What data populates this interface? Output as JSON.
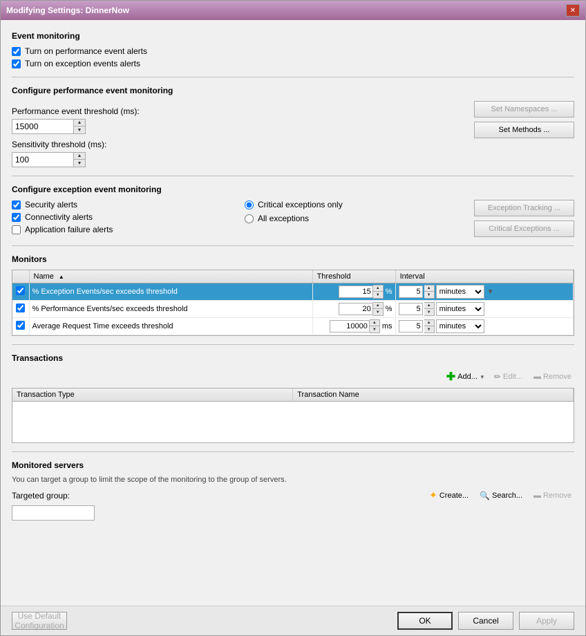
{
  "window": {
    "title": "Modifying Settings: DinnerNow"
  },
  "event_monitoring": {
    "section_title": "Event monitoring",
    "checkbox1_label": "Turn on performance event alerts",
    "checkbox2_label": "Turn on exception events alerts",
    "checkbox1_checked": true,
    "checkbox2_checked": true
  },
  "performance_monitoring": {
    "section_title": "Configure performance event monitoring",
    "perf_threshold_label": "Performance event threshold (ms):",
    "perf_threshold_value": "15000",
    "sensitivity_label": "Sensitivity threshold (ms):",
    "sensitivity_value": "100",
    "set_namespaces_label": "Set Namespaces ...",
    "set_methods_label": "Set Methods ..."
  },
  "exception_monitoring": {
    "section_title": "Configure exception event monitoring",
    "security_label": "Security alerts",
    "connectivity_label": "Connectivity alerts",
    "app_failure_label": "Application failure alerts",
    "security_checked": true,
    "connectivity_checked": true,
    "app_failure_checked": false,
    "critical_only_label": "Critical exceptions only",
    "all_exceptions_label": "All exceptions",
    "critical_only_selected": true,
    "exception_tracking_label": "Exception Tracking ...",
    "critical_exceptions_label": "Critical Exceptions ..."
  },
  "monitors": {
    "section_title": "Monitors",
    "columns": [
      "",
      "Name",
      "Threshold",
      "Interval"
    ],
    "rows": [
      {
        "checked": true,
        "name": "% Exception Events/sec exceeds threshold",
        "threshold_value": "15",
        "threshold_unit": "%",
        "interval_value": "5",
        "interval_unit": "minutes",
        "selected": true
      },
      {
        "checked": true,
        "name": "% Performance Events/sec exceeds threshold",
        "threshold_value": "20",
        "threshold_unit": "%",
        "interval_value": "5",
        "interval_unit": "minutes",
        "selected": false
      },
      {
        "checked": true,
        "name": "Average Request Time exceeds threshold",
        "threshold_value": "10000",
        "threshold_unit": "ms",
        "interval_value": "5",
        "interval_unit": "minutes",
        "selected": false
      }
    ]
  },
  "transactions": {
    "section_title": "Transactions",
    "add_label": "Add...",
    "edit_label": "Edit...",
    "remove_label": "Remove",
    "columns": [
      "Transaction Type",
      "Transaction Name"
    ]
  },
  "monitored_servers": {
    "section_title": "Monitored servers",
    "description": "You can target a group to limit the scope of the monitoring to the group of servers.",
    "targeted_group_label": "Targeted group:",
    "create_label": "Create...",
    "search_label": "Search...",
    "remove_label": "Remove"
  },
  "bottom_bar": {
    "use_default_label": "Use Default Configuration",
    "ok_label": "OK",
    "cancel_label": "Cancel",
    "apply_label": "Apply"
  }
}
